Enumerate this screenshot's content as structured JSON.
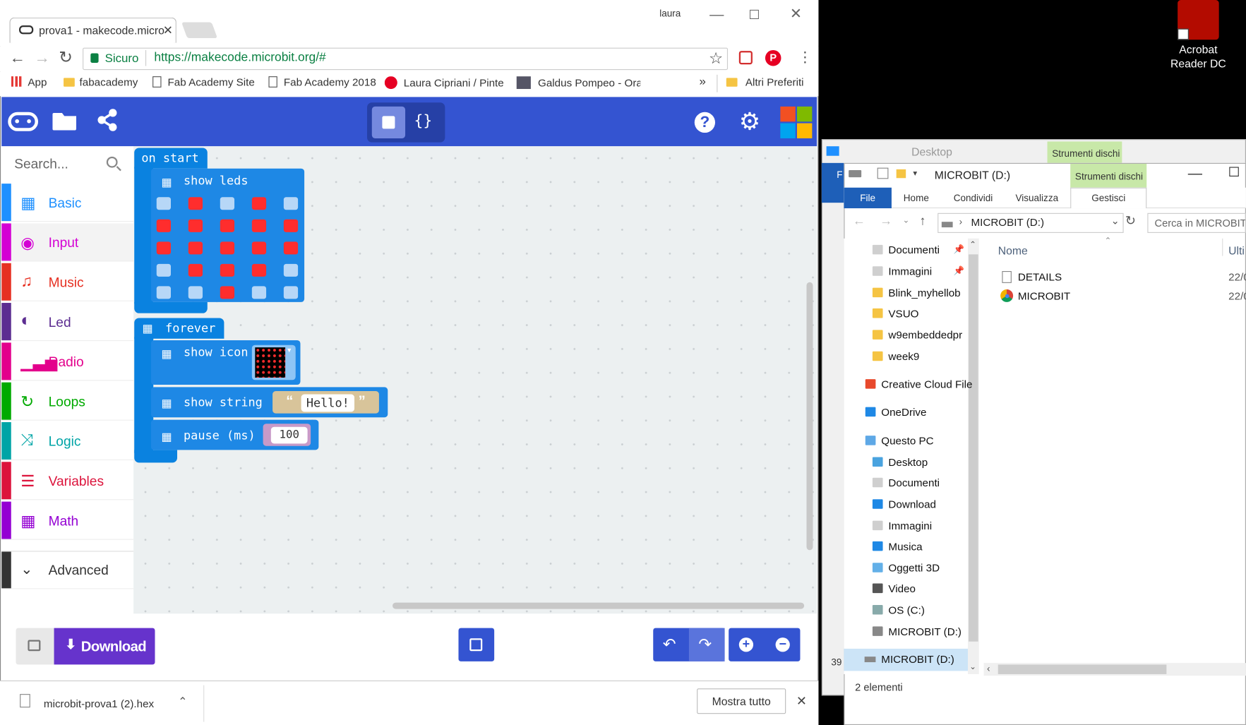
{
  "browser": {
    "tab_title": "prova1 - makecode.micro",
    "user": "laura",
    "security_label": "Sicuro",
    "url": "https://makecode.microbit.org/#",
    "bookmarks": [
      "App",
      "fabacademy",
      "Fab Academy Site",
      "Fab Academy 2018",
      "Laura Cipriani / Pinte",
      "Galdus Pompeo - Ora"
    ],
    "more_bookmarks": "»",
    "other_bookmarks": "Altri Preferiti"
  },
  "makecode": {
    "search_placeholder": "Search...",
    "categories": [
      {
        "label": "Basic",
        "color": "#1e90ff",
        "icon": "grid-icon"
      },
      {
        "label": "Input",
        "color": "#d400d4",
        "icon": "target-icon"
      },
      {
        "label": "Music",
        "color": "#e63022",
        "icon": "headphones-icon"
      },
      {
        "label": "Led",
        "color": "#5c2d91",
        "icon": "toggle-icon"
      },
      {
        "label": "Radio",
        "color": "#e3008c",
        "icon": "signal-icon"
      },
      {
        "label": "Loops",
        "color": "#00aa00",
        "icon": "refresh-icon"
      },
      {
        "label": "Logic",
        "color": "#00a4a6",
        "icon": "shuffle-icon"
      },
      {
        "label": "Variables",
        "color": "#dc143c",
        "icon": "list-icon"
      },
      {
        "label": "Math",
        "color": "#9400d3",
        "icon": "calculator-icon"
      }
    ],
    "advanced_label": "Advanced",
    "blocks": {
      "on_start": "on start",
      "show_leds": "show leds",
      "forever": "forever",
      "show_icon": "show icon",
      "show_string": "show string",
      "string_value": "Hello!",
      "pause": "pause (ms)",
      "pause_value": "100"
    },
    "leds": [
      [
        0,
        1,
        0,
        1,
        0
      ],
      [
        1,
        1,
        1,
        1,
        1
      ],
      [
        1,
        1,
        1,
        1,
        1
      ],
      [
        0,
        1,
        1,
        1,
        0
      ],
      [
        0,
        0,
        1,
        0,
        0
      ]
    ],
    "download_label": "Download"
  },
  "download_bar": {
    "file_name": "microbit-prova1 (2).hex",
    "show_all": "Mostra tutto"
  },
  "explorer": {
    "back_window_title": "Desktop",
    "ribbon_context": "Strumenti dischi",
    "title": "MICROBIT (D:)",
    "tabs": [
      "File",
      "Home",
      "Condividi",
      "Visualizza",
      "Gestisci"
    ],
    "path": "MICROBIT (D:)",
    "search_placeholder": "Cerca in MICROBIT",
    "nav_items": [
      "Documenti",
      "Immagini",
      "Blink_myhellob",
      "VSUO",
      "w9embeddedpr",
      "week9",
      "Creative Cloud File",
      "OneDrive",
      "Questo PC",
      "Desktop",
      "Documenti",
      "Download",
      "Immagini",
      "Musica",
      "Oggetti 3D",
      "Video",
      "OS (C:)",
      "MICROBIT (D:)",
      "MICROBIT (D:)"
    ],
    "column_name": "Nome",
    "column_date": "Ulti",
    "files": [
      {
        "name": "DETAILS",
        "date": "22/0"
      },
      {
        "name": "MICROBIT",
        "date": "22/0"
      }
    ],
    "status": "2 elementi",
    "left_fragment_1": "F",
    "left_fragment_2": "39"
  },
  "desktop": {
    "acrobat_line1": "Acrobat",
    "acrobat_line2": "Reader DC"
  }
}
